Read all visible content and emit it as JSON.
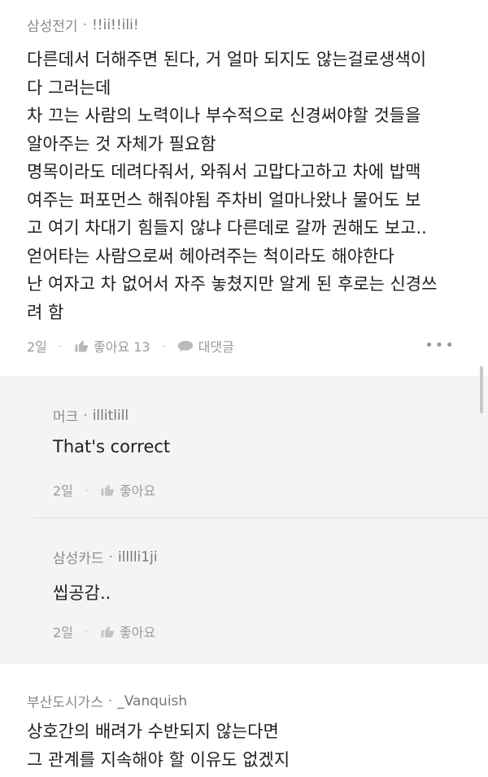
{
  "comments": [
    {
      "company": "삼성전기",
      "user": "!!ii!!ili!",
      "text": "다른데서 더해주면 된다, 거 얼마 되지도 않는걸로생색이\n다 그러는데\n차 끄는 사람의 노력이나 부수적으로 신경써야할 것들을\n알아주는 것 자체가 필요함\n명목이라도 데려다줘서, 와줘서 고맙다고하고 차에 밥맥\n여주는 퍼포먼스 해줘야됨 주차비 얼마나왔나 물어도 보\n고 여기 차대기 힘들지 않냐 다른데로 갈까 권해도 보고..\n얻어타는 사람으로써 헤아려주는 척이라도 해야한다\n난 여자고 차 없어서 자주 놓쳤지만 알게 된 후로는 신경쓰\n려 함",
      "time": "2일",
      "like_label": "좋아요 13",
      "reply_label": "대댓글",
      "more": "•••"
    }
  ],
  "replies": [
    {
      "company": "머크",
      "user": "illitlill",
      "text": "That's correct",
      "time": "2일",
      "like_label": "좋아요"
    },
    {
      "company": "삼성카드",
      "user": "illlli1ji",
      "text": "씹공감..",
      "time": "2일",
      "like_label": "좋아요"
    }
  ],
  "next_comment": {
    "company": "부산도시가스",
    "user": "_Vanquish",
    "text": "상호간의 배려가 수반되지 않는다면\n그 관계를 지속해야 할 이유도 없겠지"
  },
  "dot": "·",
  "colors": {
    "reply_bg": "#f4f4f5",
    "meta": "#8a8a8a",
    "text": "#1e1e1e"
  }
}
